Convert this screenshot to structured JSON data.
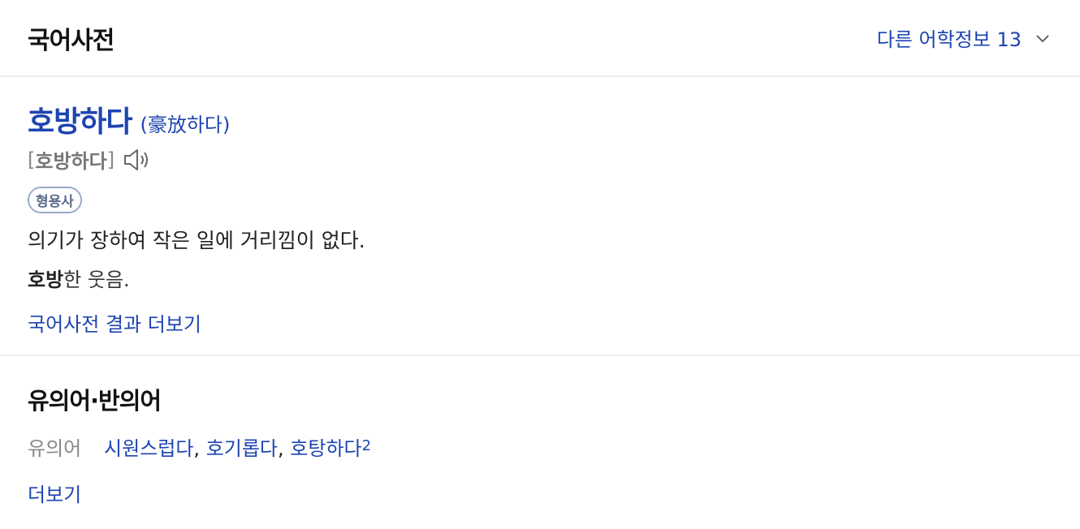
{
  "header": {
    "title": "국어사전",
    "other_info_label": "다른 어학정보 13",
    "icon": "chevron-down-icon"
  },
  "entry": {
    "headword": "호방하다",
    "hanja": "(豪放하다)",
    "pron_open": "[",
    "pron_word": "호방하다",
    "pron_close": "]",
    "speaker_icon": "speaker-icon",
    "pos": "형용사",
    "definition": "의기가 장하여 작은 일에 거리낌이 없다.",
    "example_bold": "호방",
    "example_rest": "한 웃음.",
    "more_label": "국어사전 결과 더보기"
  },
  "synonyms": {
    "title": "유의어·반의어",
    "row_label": "유의어",
    "words": [
      "시원스럽다",
      "호기롭다",
      "호탕하다"
    ],
    "separator": ",",
    "last_sup": "2",
    "more_label": "더보기"
  },
  "colors": {
    "accent": "#1d45b0",
    "muted": "#888888",
    "divider": "#ededed"
  }
}
